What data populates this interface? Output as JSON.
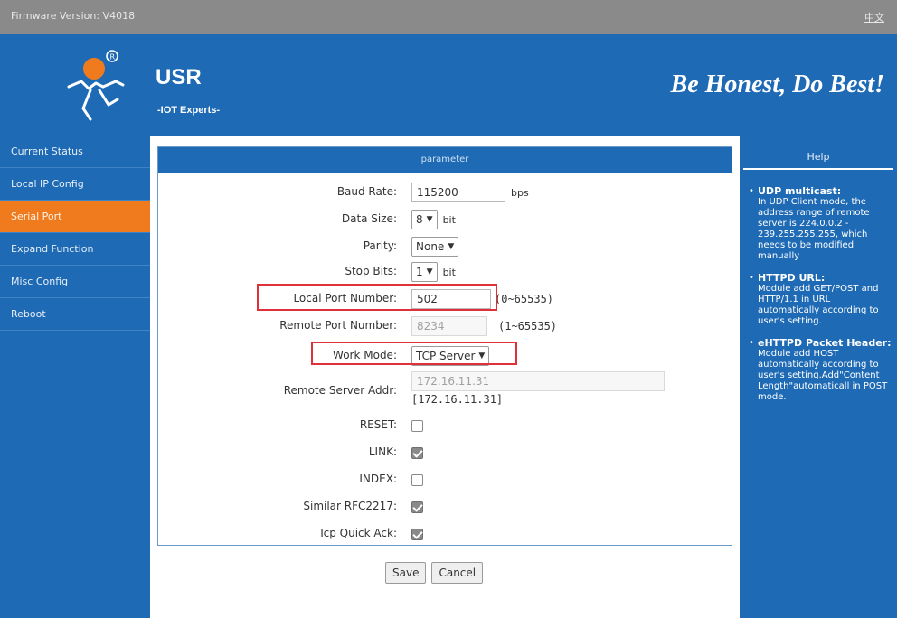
{
  "topbar": {
    "firmware": "Firmware Version: V4018",
    "language": "中文"
  },
  "header": {
    "brand": "USR",
    "subtitle": "-IOT Experts-",
    "slogan": "Be Honest, Do Best!"
  },
  "nav": {
    "items": [
      {
        "label": "Current Status"
      },
      {
        "label": "Local IP Config"
      },
      {
        "label": "Serial Port"
      },
      {
        "label": "Expand Function"
      },
      {
        "label": "Misc Config"
      },
      {
        "label": "Reboot"
      }
    ]
  },
  "panel": {
    "title": "parameter",
    "baud_rate": {
      "label": "Baud Rate:",
      "value": "115200",
      "unit": "bps"
    },
    "data_size": {
      "label": "Data Size:",
      "value": "8",
      "unit": "bit"
    },
    "parity": {
      "label": "Parity:",
      "value": "None"
    },
    "stop_bits": {
      "label": "Stop Bits:",
      "value": "1",
      "unit": "bit"
    },
    "local_port": {
      "label": "Local Port Number:",
      "value": "502",
      "range": "(0~65535)"
    },
    "remote_port": {
      "label": "Remote Port Number:",
      "value": "8234",
      "range": "(1~65535)"
    },
    "work_mode": {
      "label": "Work Mode:",
      "value": "TCP Server"
    },
    "remote_server": {
      "label": "Remote Server Addr:",
      "value": "172.16.11.31",
      "current": "[172.16.11.31]"
    },
    "reset": {
      "label": "RESET:",
      "checked": false
    },
    "link": {
      "label": "LINK:",
      "checked": true
    },
    "index": {
      "label": "INDEX:",
      "checked": false
    },
    "rfc2217": {
      "label": "Similar RFC2217:",
      "checked": true
    },
    "tcp_quick_ack": {
      "label": "Tcp Quick Ack:",
      "checked": true
    }
  },
  "buttons": {
    "save": "Save",
    "cancel": "Cancel"
  },
  "help": {
    "title": "Help",
    "items": [
      {
        "title": "UDP multicast:",
        "text": "In UDP Client mode, the address range of remote server is 224.0.0.2 - 239.255.255.255, which needs to be modified manually"
      },
      {
        "title": "HTTPD URL:",
        "text": "Module add GET/POST and HTTP/1.1 in URL automatically according to user's setting."
      },
      {
        "title": "eHTTPD Packet Header:",
        "text": "Module add HOST automatically according to user's setting.Add\"Content Length\"automaticall in POST mode."
      }
    ]
  },
  "colors": {
    "primary_blue": "#1e6ab5",
    "active_orange": "#f07b1e",
    "highlight_red": "#e0303a",
    "top_bar_grey": "#8a8a8a"
  }
}
